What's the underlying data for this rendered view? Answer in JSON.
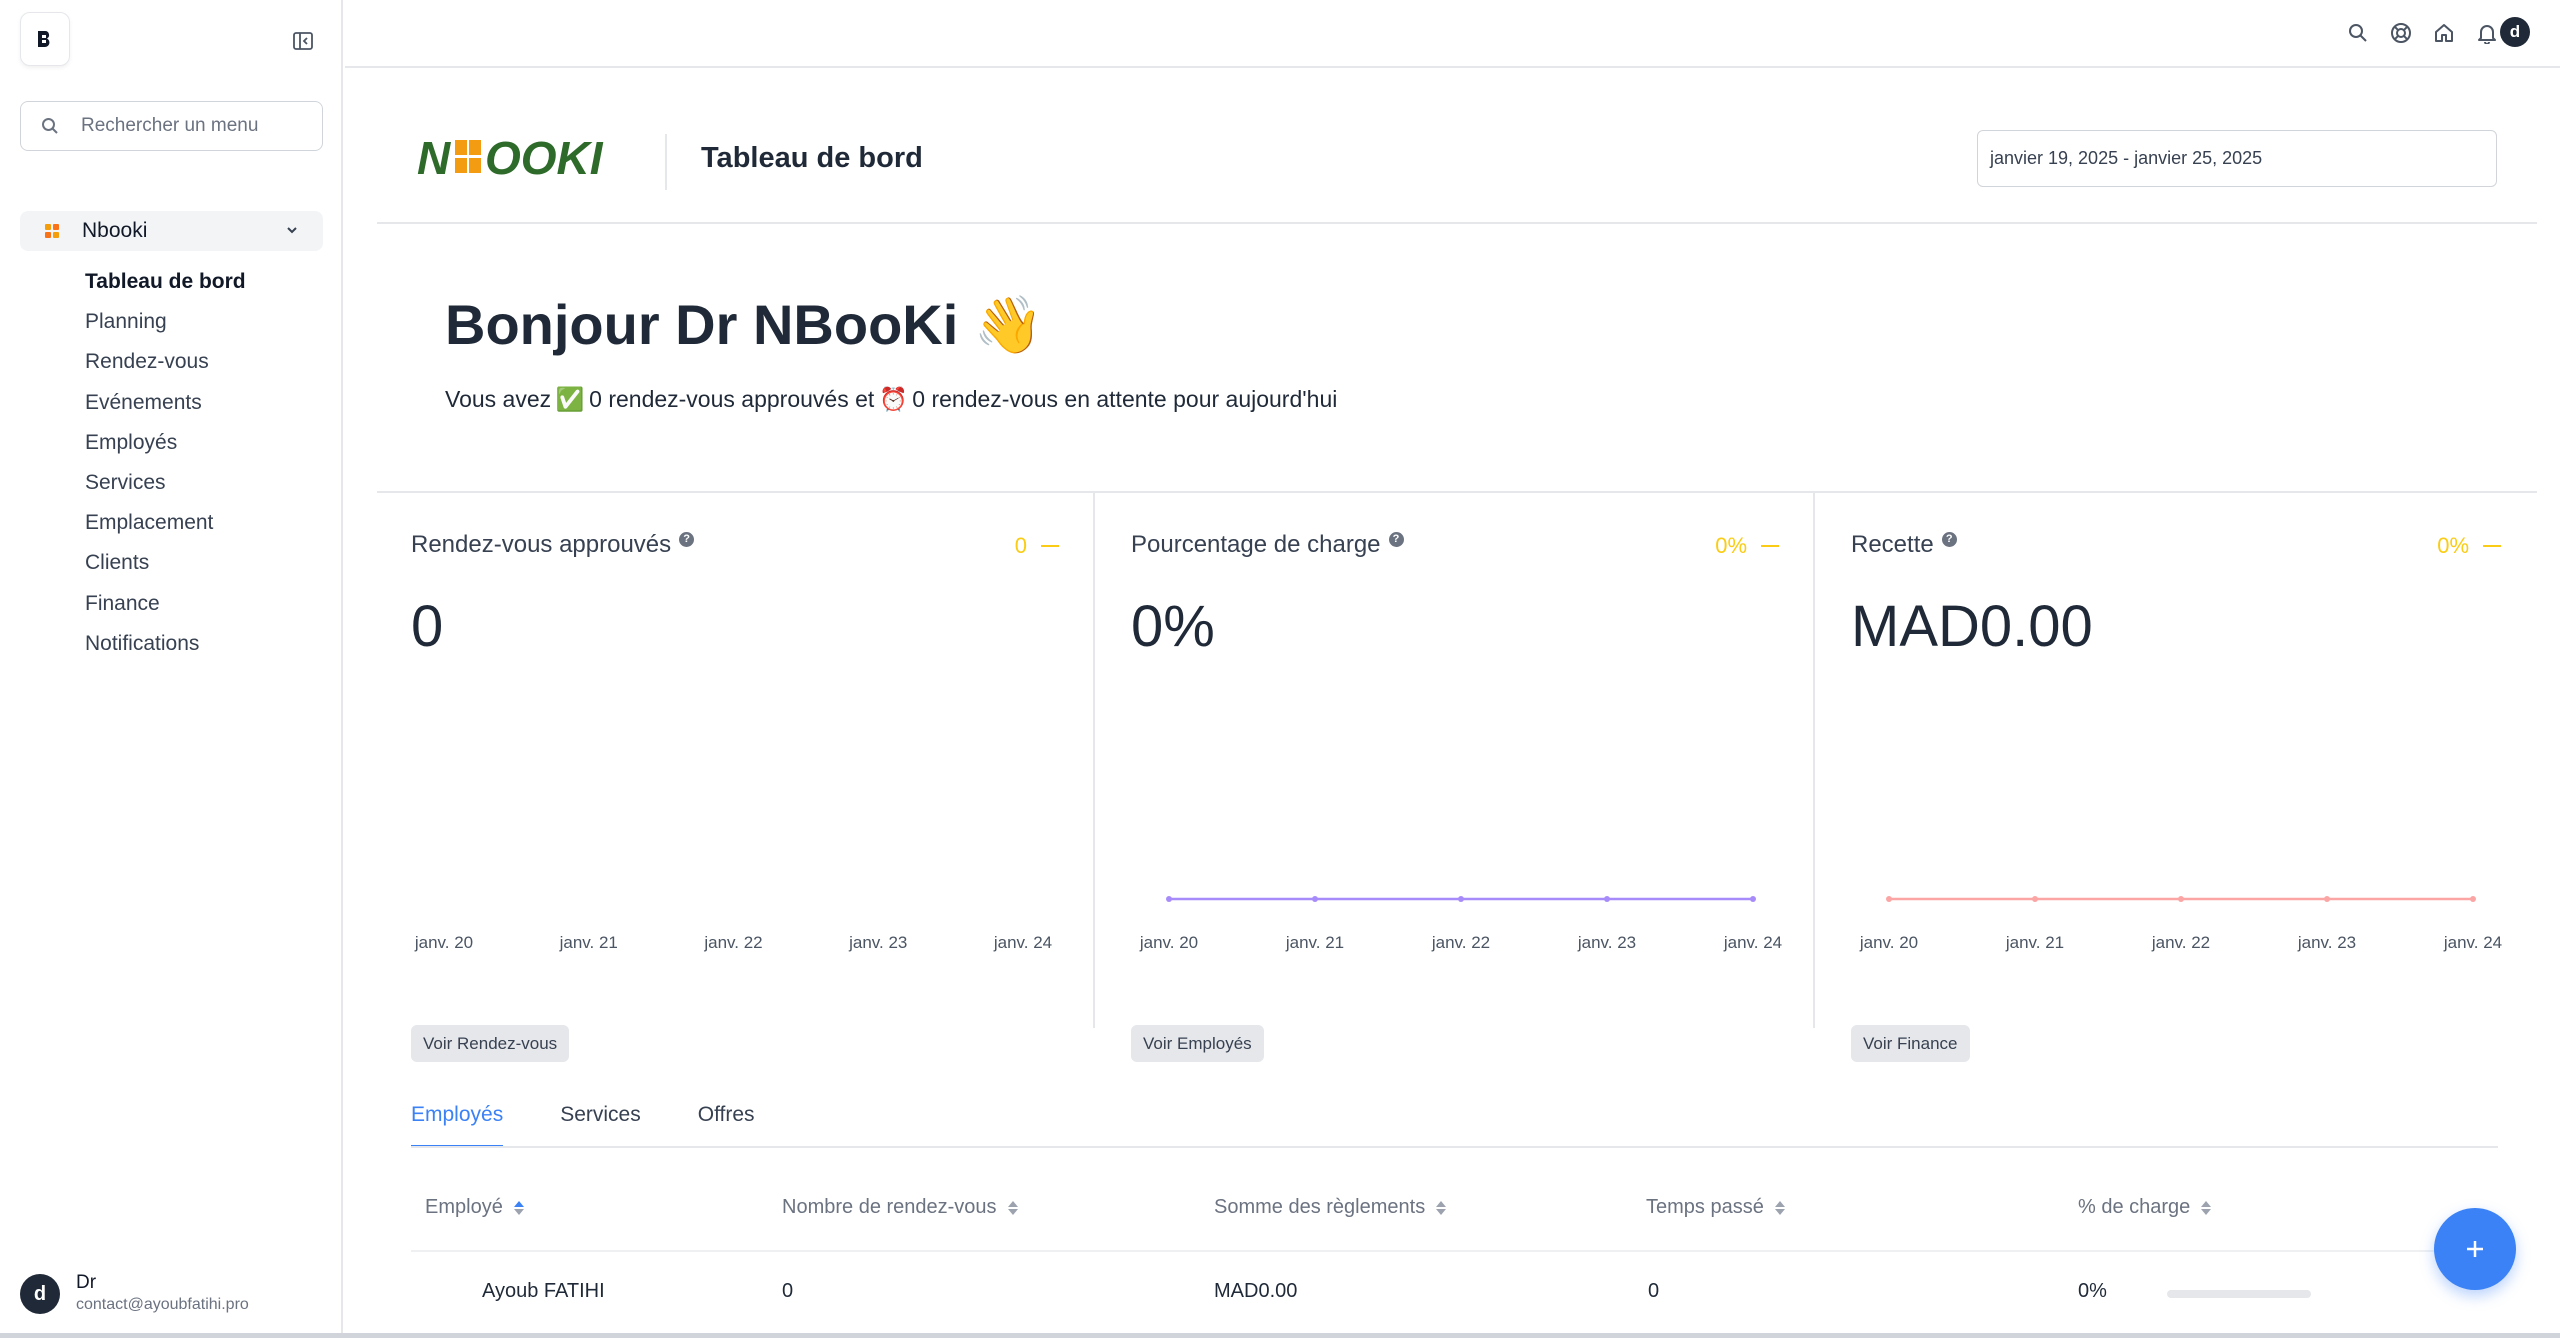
{
  "sidebar": {
    "search_placeholder": "Rechercher un menu",
    "group_label": "Nbooki",
    "items": [
      {
        "label": "Tableau de bord",
        "active": true
      },
      {
        "label": "Planning"
      },
      {
        "label": "Rendez-vous"
      },
      {
        "label": "Evénements"
      },
      {
        "label": "Employés"
      },
      {
        "label": "Services"
      },
      {
        "label": "Emplacement"
      },
      {
        "label": "Clients"
      },
      {
        "label": "Finance"
      },
      {
        "label": "Notifications"
      }
    ],
    "user": {
      "initial": "d",
      "name": "Dr",
      "email": "contact@ayoubfatihi.pro"
    }
  },
  "topbar": {
    "icons": [
      "search-icon",
      "help-icon",
      "home-icon",
      "bell-icon"
    ],
    "avatar_initial": "d"
  },
  "header": {
    "brand": "NBOOKI",
    "title": "Tableau de bord",
    "date_range": "janvier 19, 2025 - janvier 25, 2025"
  },
  "welcome": {
    "greeting": "Bonjour Dr NBooKi",
    "greeting_emoji": "👋",
    "pre": "Vous avez",
    "approved_emoji": "✅",
    "approved_text": "0 rendez-vous approuvés et",
    "pending_emoji": "⏰",
    "pending_text": "0 rendez-vous en attente pour aujourd'hui"
  },
  "stats": [
    {
      "title": "Rendez-vous approuvés",
      "change": "0",
      "value": "0",
      "button": "Voir Rendez-vous",
      "line_color": "",
      "show_line": false
    },
    {
      "title": "Pourcentage de charge",
      "change": "0%",
      "value": "0%",
      "button": "Voir Employés",
      "line_color": "#a78bfa",
      "show_line": true
    },
    {
      "title": "Recette",
      "change": "0%",
      "value": "MAD0.00",
      "button": "Voir Finance",
      "line_color": "#fca5a5",
      "show_line": true
    }
  ],
  "chart_data": [
    {
      "type": "bar",
      "categories": [
        "janv. 20",
        "janv. 21",
        "janv. 22",
        "janv. 23",
        "janv. 24"
      ],
      "series": [
        {
          "values": [
            0,
            0,
            0,
            0,
            0
          ]
        }
      ]
    },
    {
      "type": "line",
      "categories": [
        "janv. 20",
        "janv. 21",
        "janv. 22",
        "janv. 23",
        "janv. 24"
      ],
      "series": [
        {
          "values": [
            0,
            0,
            0,
            0,
            0
          ]
        }
      ]
    },
    {
      "type": "line",
      "categories": [
        "janv. 20",
        "janv. 21",
        "janv. 22",
        "janv. 23",
        "janv. 24"
      ],
      "series": [
        {
          "values": [
            0,
            0,
            0,
            0,
            0
          ]
        }
      ]
    }
  ],
  "tabs": [
    {
      "label": "Employés",
      "active": true
    },
    {
      "label": "Services"
    },
    {
      "label": "Offres"
    }
  ],
  "table": {
    "headers": [
      "Employé",
      "Nombre de rendez-vous",
      "Somme des règlements",
      "Temps passé",
      "% de charge"
    ],
    "rows": [
      {
        "employee": "Ayoub FATIHI",
        "appointments": "0",
        "payments": "MAD0.00",
        "time": "0",
        "charge": "0%",
        "charge_fraction": 0
      }
    ]
  },
  "fab_icon": "plus-icon",
  "colors": {
    "accent": "#3b82f6",
    "change": "#facc15",
    "brand_green": "#2e6b2a",
    "brand_orange": "#f39c12"
  }
}
